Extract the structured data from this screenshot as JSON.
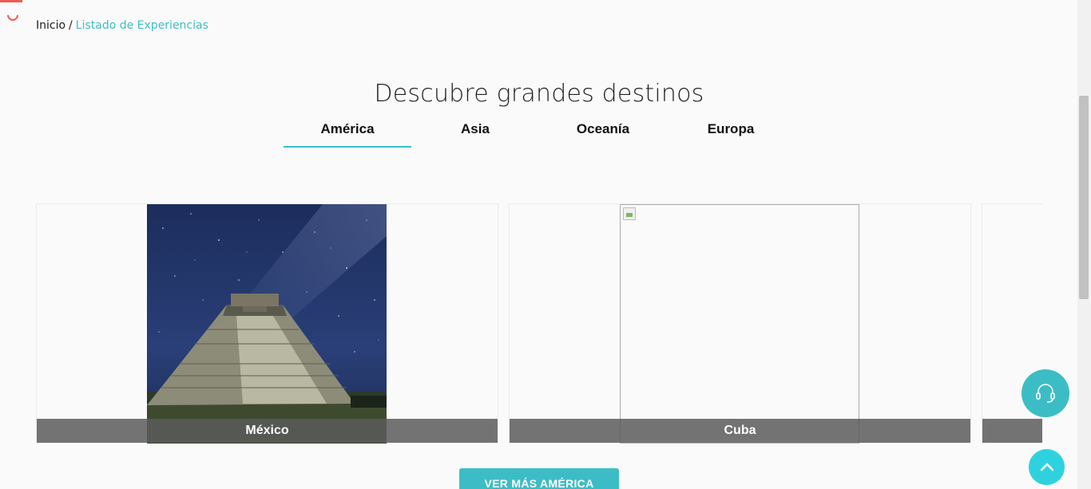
{
  "breadcrumb": {
    "home": "Inicio",
    "separator": "/",
    "current": "Listado de Experiencias"
  },
  "page": {
    "title": "Descubre grandes destinos"
  },
  "tabs": [
    {
      "label": "América",
      "active": true
    },
    {
      "label": "Asia",
      "active": false
    },
    {
      "label": "Oceanía",
      "active": false
    },
    {
      "label": "Europa",
      "active": false
    }
  ],
  "destinations": [
    {
      "name": "México",
      "image": "pyramid-night-sky"
    },
    {
      "name": "Cuba",
      "image": "broken-image"
    }
  ],
  "more_button": {
    "label": "VER MÁS AMÉRICA"
  },
  "floating": {
    "support_icon": "headset-icon",
    "top_icon": "chevron-up-icon"
  },
  "colors": {
    "accent": "#3cbdc5",
    "loader": "#f05a4f",
    "caption_bg": "#5a5a5a"
  }
}
